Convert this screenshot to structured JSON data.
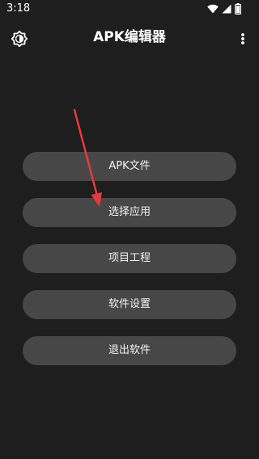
{
  "status_bar": {
    "time": "3:18",
    "icons": [
      "wifi-icon",
      "signal-icon",
      "battery-icon"
    ]
  },
  "app_bar": {
    "title": "APK编辑器",
    "left_icon": "theme-settings-icon",
    "right_icon": "more-vert-icon"
  },
  "menu": {
    "items": [
      {
        "label": "APK文件"
      },
      {
        "label": "选择应用"
      },
      {
        "label": "项目工程"
      },
      {
        "label": "软件设置"
      },
      {
        "label": "退出软件"
      }
    ]
  },
  "annotation": {
    "type": "arrow",
    "color": "#e5393b",
    "points_to": "选择应用"
  },
  "colors": {
    "background": "#1e1e1e",
    "button": "#474747",
    "text": "#ffffff",
    "arrow": "#e5393b"
  }
}
